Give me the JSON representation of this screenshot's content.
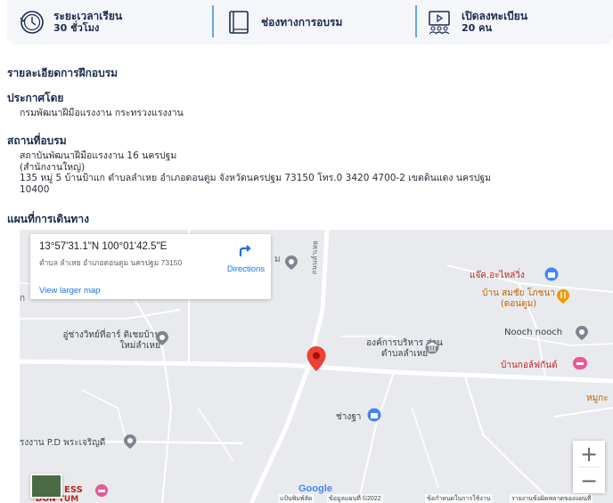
{
  "info": {
    "duration_label": "ระยะเวลาเรียน",
    "duration_value": "30 ชั่วโมง",
    "channel_label": "ช่องทางการอบรม",
    "enroll_label": "เปิดลงทะเบียน",
    "enroll_value": "20 คน"
  },
  "details": {
    "title": "รายละเอียดการฝึกอบรม",
    "announced_by_title": "ประกาศโดย",
    "announced_by": "กรมพัฒนาฝีมือแรงงาน กระทรวงแรงงาน",
    "location_title": "สถานที่อบรม",
    "location_line1": "สถาบันพัฒนาฝีมือแรงงาน 16 นครปฐม",
    "location_line2": "(สำนักงานใหญ่)",
    "location_line3": "135 หมู่ 5 บ้านป้าแก ตำบลลำเหย อำเภอดอนตูม จังหวัดนครปฐม 73150 โทร.0 3420 4700-2 เขตดินแดง นครปฐม",
    "location_line4": "10400",
    "map_title": "แผนที่การเดินทาง"
  },
  "map": {
    "coords": "13°57'31.1\"N 100°01'42.5\"E",
    "address": "ตำบล ลำเหย อำเภอดอนตูม นครปฐม 73150",
    "view_larger": "View larger map",
    "directions": "Directions",
    "labels": {
      "left_edge": "ก",
      "poi_m": "ม",
      "autopart": "แจ๊ค.อะไหล่วิ่ง",
      "restaurant": "บ้าน สมชัย โภชนา (ดอนตูม)",
      "mechanic": "อู่ช่างวิทย์ที่อาร์ ติเชยบ้านใหม่ลำเหย",
      "tao": "องค์การบริหาร ส่วนตำบลลำเหย",
      "nooch": "Nooch nooch",
      "golf": "บ้านกอล์ฟกันต์",
      "mhu": "หมูกะ",
      "changtha": "ช่างฐา",
      "factory": "รงงาน P.D พระเจริญดี",
      "princess": "ESS",
      "donTum": "DON TUM",
      "road": "ถนนลำเหย"
    },
    "zoom_in": "+",
    "zoom_out": "−",
    "google": "Google",
    "footer_keyboard": "แป้นพิมพ์ลัด",
    "footer_mapdata": "ข้อมูลแผนที่ ©2022",
    "footer_terms": "ข้อกำหนดในการใช้งาน",
    "footer_report": "รายงานข้อผิดพลาดของแผนที่"
  },
  "colors": {
    "accent_blue": "#6aa7e0",
    "pin_red": "#ea4335",
    "link_blue": "#1a73e8"
  }
}
